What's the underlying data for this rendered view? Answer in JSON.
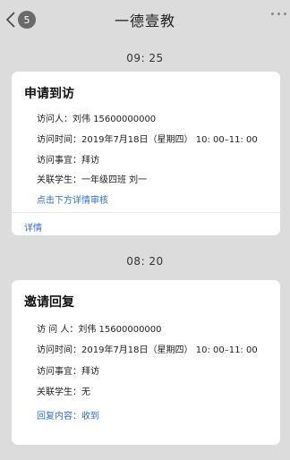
{
  "nav": {
    "badge_count": "5",
    "title": "一德壹教"
  },
  "messages": [
    {
      "time": "09: 25",
      "title": "申请到访",
      "rows": [
        "访问人：刘伟    15600000000",
        "访问时间：2019年7月18日（星期四） 10: 00–11: 00",
        "访问事宜：拜访",
        "关联学生：一年级四班  刘一"
      ],
      "hint": "点击下方详情审核",
      "detail_label": "详情"
    },
    {
      "time": "08: 20",
      "title": "邀请回复",
      "rows": [
        "访 问 人：刘伟     15600000000",
        "访问时间：2019年7月18日（星期四） 10: 00–11: 00",
        "访问事宜：拜访",
        "关联学生：无"
      ],
      "reply": "回复内容：收到"
    }
  ]
}
